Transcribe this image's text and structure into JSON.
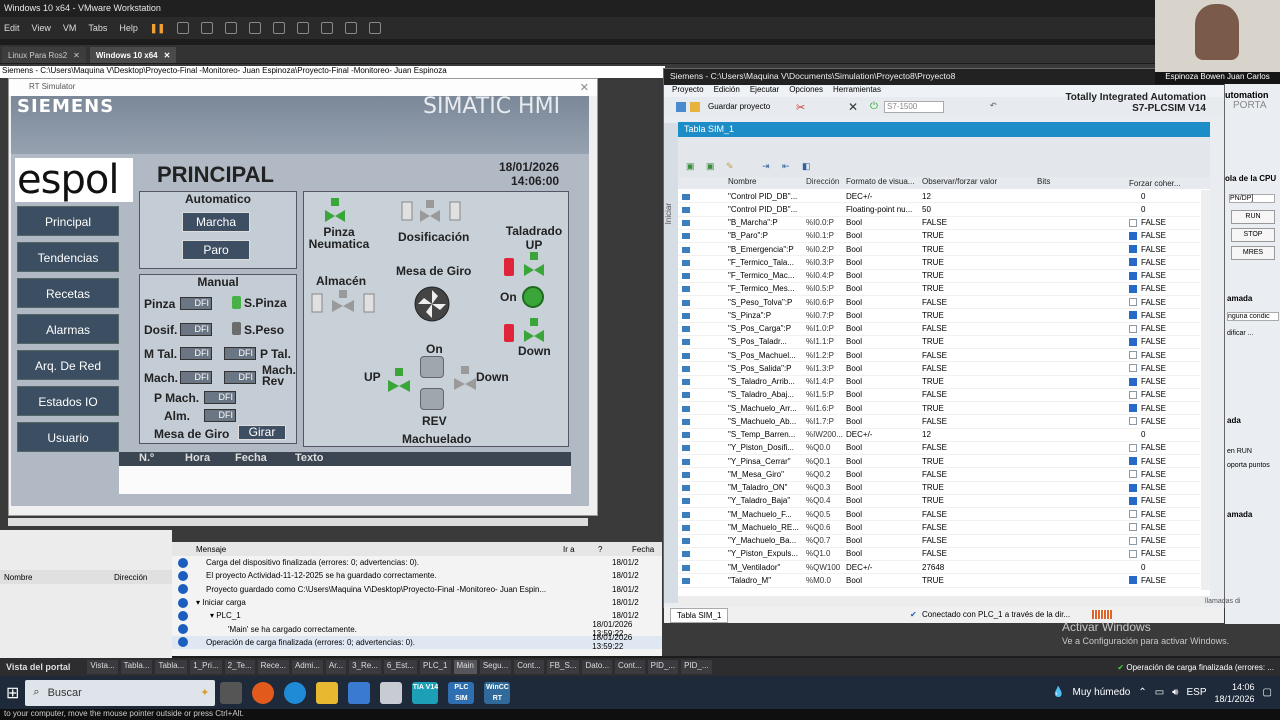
{
  "vmware": {
    "title": "Windows 10 x64 - VMware Workstation",
    "menu": [
      "Edit",
      "View",
      "VM",
      "Tabs",
      "Help"
    ],
    "tabs": [
      "Linux Para Ros2",
      "Windows 10 x64"
    ],
    "portal_path": "Siemens - C:\\Users\\Maquina V\\Desktop\\Proyecto-Final -Monitoreo- Juan Espinoza\\Proyecto-Final -Monitoreo- Juan Espinoza"
  },
  "rt": {
    "window_title": "RT Simulator",
    "brand": "SIEMENS",
    "product": "SIMATIC HMI",
    "logo": "espol",
    "screen_title": "PRINCIPAL",
    "date": "18/01/2026",
    "time": "14:06:00",
    "nav": [
      "Principal",
      "Tendencias",
      "Recetas",
      "Alarmas",
      "Arq. De Red",
      "Estados IO",
      "Usuario"
    ],
    "auto": {
      "title": "Automatico",
      "start": "Marcha",
      "stop": "Paro"
    },
    "manual": {
      "title": "Manual",
      "pinza": "Pinza",
      "s_pinza": "S.Pinza",
      "dosif": "Dosif.",
      "s_peso": "S.Peso",
      "m_tal": "M Tal.",
      "p_tal": "P Tal.",
      "mach": "Mach.",
      "mach_rev": "Mach. Rev",
      "p_mach": "P Mach.",
      "alm": "Alm.",
      "mesa": "Mesa de Giro",
      "girar": "Girar",
      "dfi": "DFI"
    },
    "process": {
      "pinza": "Pinza Neumatica",
      "dosif": "Dosificación",
      "taladrado": "Taladrado UP",
      "almacen": "Almacén",
      "mesa": "Mesa de Giro",
      "on1": "On",
      "down1": "Down",
      "on2": "On",
      "up": "UP",
      "down2": "Down",
      "rev": "REV",
      "machuelado": "Machuelado"
    },
    "alarm_headers": [
      "N.º",
      "Hora",
      "Fecha",
      "Texto"
    ]
  },
  "messages": {
    "props_cols": [
      "Nombre",
      "Dirección"
    ],
    "header": "Mensaje",
    "col_in": "Ir a",
    "col_q": "?",
    "col_date": "Fecha",
    "rows": [
      {
        "text": "Carga del dispositivo finalizada (errores: 0; advertencias: 0).",
        "date": "18/01/2"
      },
      {
        "text": "El proyecto Actividad-11-12-2025 se ha guardado correctamente.",
        "date": "18/01/2"
      },
      {
        "text": "Proyecto guardado como C:\\Users\\Maquina V\\Desktop\\Proyecto-Final -Monitoreo- Juan Espin...",
        "date": "18/01/2"
      },
      {
        "text": "Iniciar carga",
        "date": "18/01/2"
      },
      {
        "text": "PLC_1",
        "date": "18/01/2"
      },
      {
        "text": "'Main' se ha cargado correctamente.",
        "date": "18/01/2026  13:59:22"
      },
      {
        "text": "Operación de carga finalizada (errores: 0; advertencias: 0).",
        "date": "18/01/2026  13:59:22"
      }
    ]
  },
  "tia": {
    "title": "Siemens - C:\\Users\\Maquina V\\Documents\\Simulation\\Proyecto8\\Proyecto8",
    "menu": [
      "Proyecto",
      "Edición",
      "Ejecutar",
      "Opciones",
      "Herramientas"
    ],
    "save": "Guardar proyecto",
    "cpu": "S7-1500",
    "brand1": "Totally Integrated Automation",
    "brand2": "S7-PLCSIM V14",
    "table_title": "Tabla SIM_1",
    "side_label": "Iniciar",
    "columns": [
      "Nombre",
      "Dirección",
      "Formato de visua...",
      "Observar/forzar valor",
      "Bits",
      "Forzar coher..."
    ],
    "rows": [
      [
        "\"Control PID_DB\"...",
        "",
        "DEC+/-",
        "12",
        0,
        "0"
      ],
      [
        "\"Control PID_DB\"...",
        "",
        "Floating-point nu...",
        "50",
        0,
        "0"
      ],
      [
        "\"B_Marcha\":P",
        "%I0.0:P",
        "Bool",
        "FALSE",
        1,
        "FALSE"
      ],
      [
        "\"B_Paro\":P",
        "%I0.1:P",
        "Bool",
        "TRUE",
        2,
        "FALSE"
      ],
      [
        "\"B_Emergencia\":P",
        "%I0.2:P",
        "Bool",
        "TRUE",
        2,
        "FALSE"
      ],
      [
        "\"F_Termico_Tala...",
        "%I0.3:P",
        "Bool",
        "TRUE",
        2,
        "FALSE"
      ],
      [
        "\"F_Termico_Mac...",
        "%I0.4:P",
        "Bool",
        "TRUE",
        2,
        "FALSE"
      ],
      [
        "\"F_Termico_Mes...",
        "%I0.5:P",
        "Bool",
        "TRUE",
        2,
        "FALSE"
      ],
      [
        "\"S_Peso_Tolva\":P",
        "%I0.6:P",
        "Bool",
        "FALSE",
        1,
        "FALSE"
      ],
      [
        "\"S_Pinza\":P",
        "%I0.7:P",
        "Bool",
        "TRUE",
        2,
        "FALSE"
      ],
      [
        "\"S_Pos_Carga\":P",
        "%I1.0:P",
        "Bool",
        "FALSE",
        1,
        "FALSE"
      ],
      [
        "\"S_Pos_Taladr...",
        "%I1.1:P",
        "Bool",
        "TRUE",
        2,
        "FALSE"
      ],
      [
        "\"S_Pos_Machuel...",
        "%I1.2:P",
        "Bool",
        "FALSE",
        1,
        "FALSE"
      ],
      [
        "\"S_Pos_Salida\":P",
        "%I1.3:P",
        "Bool",
        "FALSE",
        1,
        "FALSE"
      ],
      [
        "\"S_Taladro_Arrib...",
        "%I1.4:P",
        "Bool",
        "TRUE",
        2,
        "FALSE"
      ],
      [
        "\"S_Taladro_Abaj...",
        "%I1.5:P",
        "Bool",
        "FALSE",
        1,
        "FALSE"
      ],
      [
        "\"S_Machuelo_Arr...",
        "%I1.6:P",
        "Bool",
        "TRUE",
        2,
        "FALSE"
      ],
      [
        "\"S_Machuelo_Ab...",
        "%I1.7:P",
        "Bool",
        "FALSE",
        1,
        "FALSE"
      ],
      [
        "\"S_Temp_Barren...",
        "%IW200...",
        "DEC+/-",
        "12",
        0,
        "0"
      ],
      [
        "\"Y_Piston_Dosifi...",
        "%Q0.0",
        "Bool",
        "FALSE",
        1,
        "FALSE"
      ],
      [
        "\"Y_Pinsa_Cerrar\"",
        "%Q0.1",
        "Bool",
        "TRUE",
        2,
        "FALSE"
      ],
      [
        "\"M_Mesa_Giro\"",
        "%Q0.2",
        "Bool",
        "FALSE",
        1,
        "FALSE"
      ],
      [
        "\"M_Taladro_ON\"",
        "%Q0.3",
        "Bool",
        "TRUE",
        2,
        "FALSE"
      ],
      [
        "\"Y_Taladro_Baja\"",
        "%Q0.4",
        "Bool",
        "TRUE",
        2,
        "FALSE"
      ],
      [
        "\"M_Machuelo_F...",
        "%Q0.5",
        "Bool",
        "FALSE",
        1,
        "FALSE"
      ],
      [
        "\"M_Machuelo_RE...",
        "%Q0.6",
        "Bool",
        "FALSE",
        1,
        "FALSE"
      ],
      [
        "\"Y_Machuelo_Ba...",
        "%Q0.7",
        "Bool",
        "FALSE",
        1,
        "FALSE"
      ],
      [
        "\"Y_Piston_Expuls...",
        "%Q1.0",
        "Bool",
        "FALSE",
        1,
        "FALSE"
      ],
      [
        "\"M_Ventilador\"",
        "%QW100",
        "DEC+/-",
        "27648",
        0,
        "0"
      ],
      [
        "\"Taladro_M\"",
        "%M0.0",
        "Bool",
        "TRUE",
        2,
        "FALSE"
      ]
    ],
    "status_tab": "Tabla SIM_1",
    "status": "Conectado con PLC_1 a través de la dir..."
  },
  "right_panel": {
    "webcam_name": "Espinoza Bowen Juan Carlos",
    "items": [
      "utomation",
      "PORTA",
      "ola de la CPU",
      "PN/DP]",
      "RUN",
      "STOP",
      "MRES",
      "amada",
      "nguna condic",
      "dificar ...",
      "ada",
      "en RUN",
      "oporta puntos",
      "amada",
      "llamadas di"
    ]
  },
  "activate": {
    "line1": "Activar Windows",
    "line2": "Ve a Configuración para activar Windows."
  },
  "statusbar": {
    "portal": "Vista del portal",
    "items": [
      "Vista...",
      "Tabla...",
      "Tabla...",
      "1_Pri...",
      "2_Te...",
      "Rece...",
      "Admi...",
      "Ar...",
      "3_Re...",
      "6_Est...",
      "PLC_1",
      "Main",
      "Segu...",
      "Cont...",
      "FB_S...",
      "Dato...",
      "Cont...",
      "PID_...",
      "PID_..."
    ],
    "message": "Operación de carga finalizada (errores: ..."
  },
  "taskbar": {
    "search": "Buscar",
    "apps": [
      "TIA V14",
      "PLC SIM",
      "WinCC RT"
    ],
    "weather": "Muy húmedo",
    "lang": "ESP",
    "time": "14:06",
    "date": "18/1/2026"
  },
  "tip": "to your computer, move the mouse pointer outside or press Ctrl+Alt."
}
